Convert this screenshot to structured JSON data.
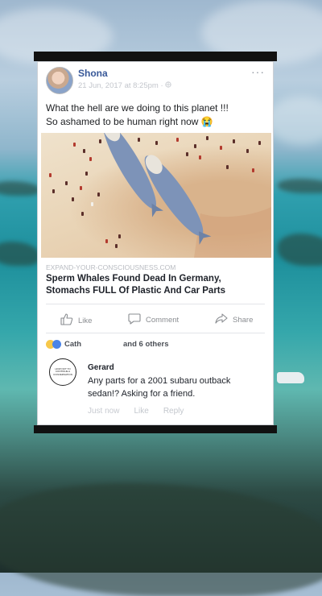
{
  "post": {
    "author": "Shona",
    "timestamp": "21 Jun, 2017 at 8:25pm",
    "privacy_icon": "globe-icon",
    "text_line1": "What the hell are we doing to this planet !!!",
    "text_line2": "So ashamed to be human right now 😭"
  },
  "link": {
    "domain": "EXPAND-YOUR-CONSCIOUSNESS.COM",
    "title_line1": "Sperm Whales Found Dead In Germany,",
    "title_line2": "Stomachs FULL Of Plastic And Car Parts"
  },
  "actions": {
    "like": "Like",
    "comment": "Comment",
    "share": "Share"
  },
  "reactions": {
    "first_name": "Cath",
    "others": "and 6 others"
  },
  "comment": {
    "author": "Gerard",
    "line1": "Any parts for a 2001 subaru outback",
    "line2": "sedan!? Asking for a friend.",
    "avatar_text": "HOW NOT TO CONTINUE A CONVERSATION",
    "time": "Just now",
    "like": "Like",
    "reply": "Reply"
  },
  "colors": {
    "name_blue": "#385898",
    "card_border": "#ccd0d5"
  }
}
